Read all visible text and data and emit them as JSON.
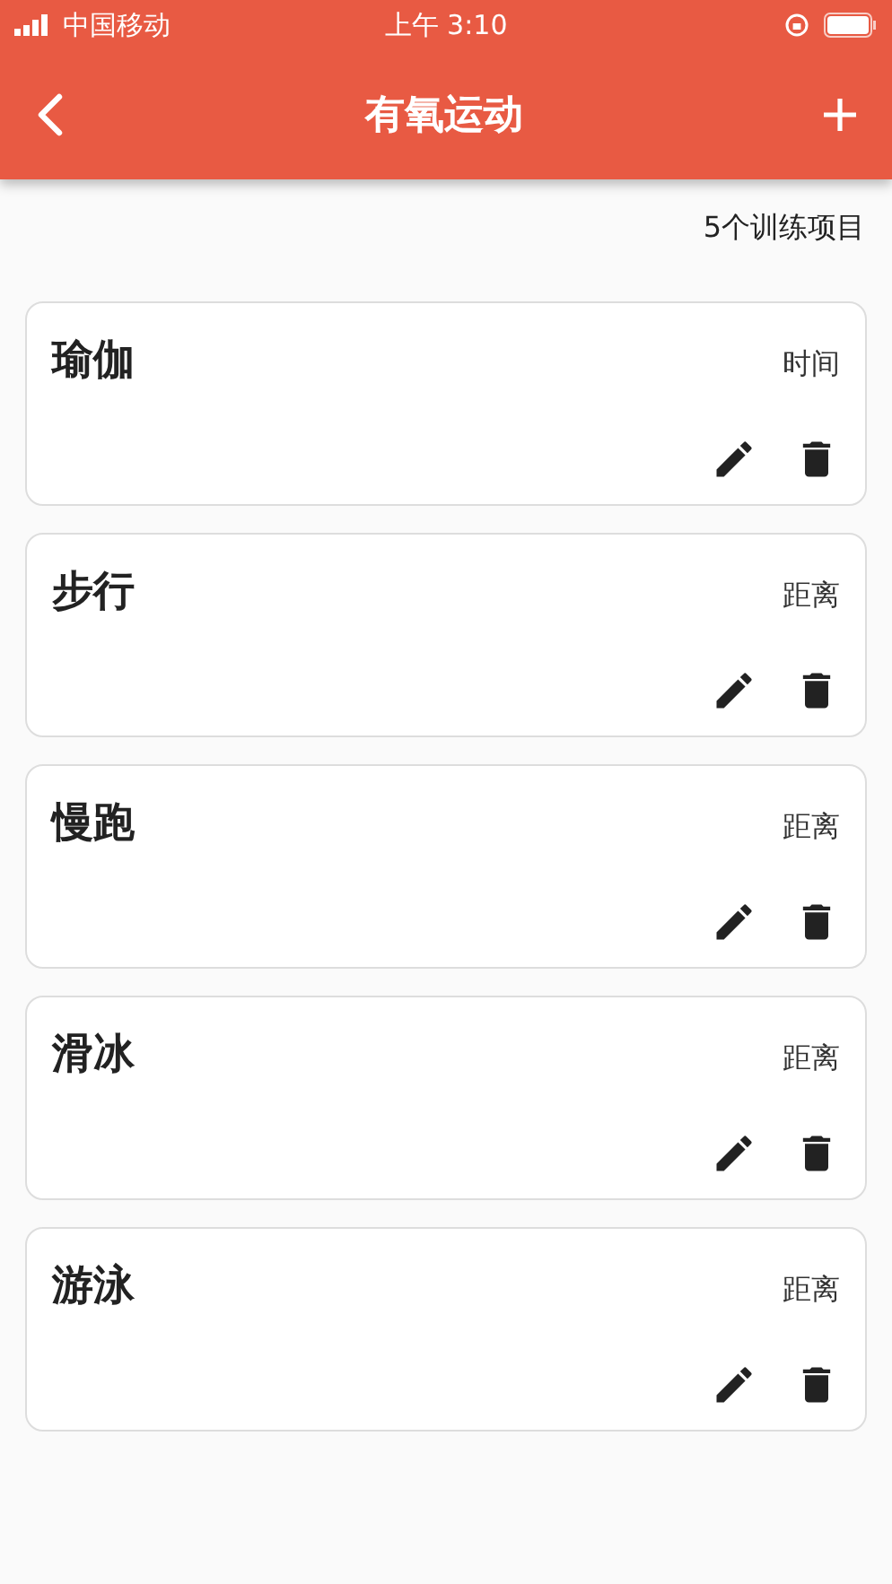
{
  "status_bar": {
    "carrier": "中国移动",
    "time": "上午 3:10"
  },
  "app_bar": {
    "title": "有氧运动"
  },
  "count": "5个训练项目",
  "exercises": [
    {
      "name": "瑜伽",
      "measure": "时间"
    },
    {
      "name": "步行",
      "measure": "距离"
    },
    {
      "name": "慢跑",
      "measure": "距离"
    },
    {
      "name": "滑冰",
      "measure": "距离"
    },
    {
      "name": "游泳",
      "measure": "距离"
    }
  ]
}
